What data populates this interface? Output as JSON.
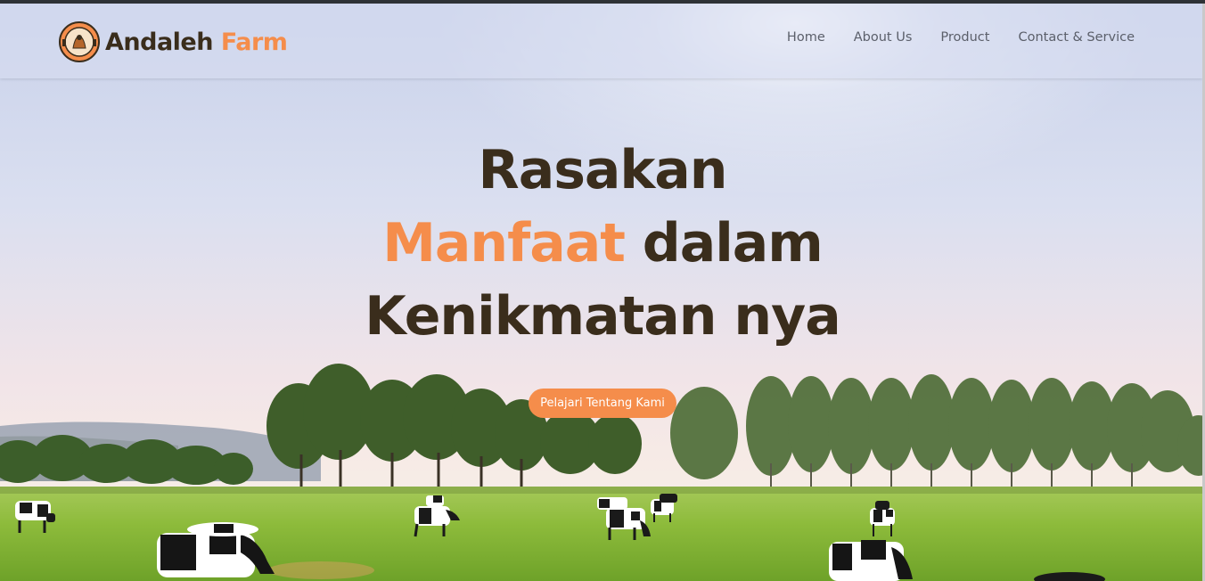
{
  "brand": {
    "name_part1": "Andaleh",
    "name_part2": "Farm",
    "logo_text_top": "ANDALEH",
    "logo_text_bottom": "FARM"
  },
  "nav": {
    "items": [
      {
        "label": "Home"
      },
      {
        "label": "About Us"
      },
      {
        "label": "Product"
      },
      {
        "label": "Contact & Service"
      }
    ]
  },
  "hero": {
    "line1": "Rasakan",
    "line2_accent": "Manfaat",
    "line2_rest": " dalam",
    "line3": "Kenikmatan nya",
    "cta_label": "Pelajari Tentang Kami"
  },
  "colors": {
    "accent": "#f58d4b",
    "dark_text": "#3a2d1c",
    "nav_text": "#5b5f6a",
    "grass": "#8bbd3c",
    "sky": "#d9ddee"
  },
  "icons": {
    "logo": "farm-logo-icon"
  }
}
